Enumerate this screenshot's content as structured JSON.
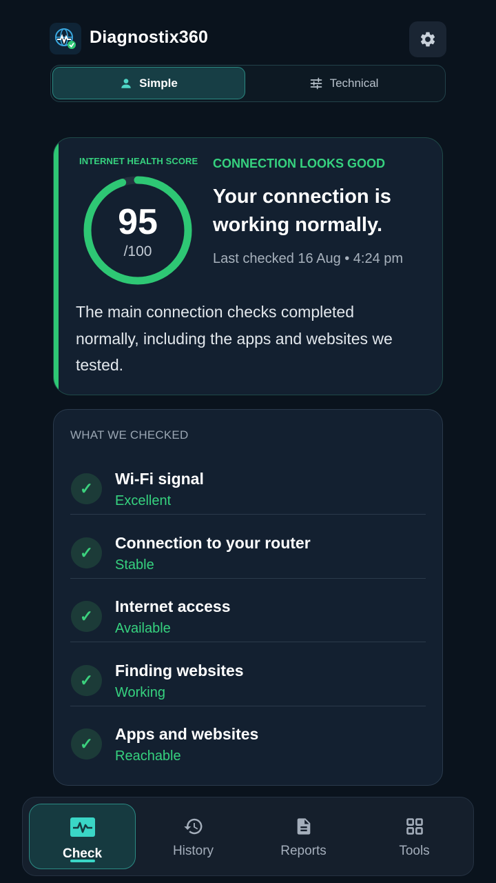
{
  "app": {
    "title": "Diagnostix360"
  },
  "mode_toggle": {
    "simple_label": "Simple",
    "technical_label": "Technical",
    "selected": "Simple"
  },
  "score_card": {
    "score_label": "INTERNET HEALTH SCORE",
    "score": "95",
    "score_max": "/100",
    "score_fraction": 0.95,
    "status_label": "CONNECTION LOOKS GOOD",
    "headline": "Your connection is working normally.",
    "last_checked": "Last checked 16 Aug • 4:24 pm",
    "summary": "The main connection checks completed normally, including the apps and websites we tested."
  },
  "checks": {
    "title": "WHAT WE CHECKED",
    "items": [
      {
        "name": "Wi-Fi signal",
        "status": "Excellent"
      },
      {
        "name": "Connection to your router",
        "status": "Stable"
      },
      {
        "name": "Internet access",
        "status": "Available"
      },
      {
        "name": "Finding websites",
        "status": "Working"
      },
      {
        "name": "Apps and websites",
        "status": "Reachable"
      }
    ]
  },
  "bottom_nav": {
    "items": [
      {
        "label": "Check",
        "icon": "pulse-icon"
      },
      {
        "label": "History",
        "icon": "history-icon"
      },
      {
        "label": "Reports",
        "icon": "document-icon"
      },
      {
        "label": "Tools",
        "icon": "grid-icon"
      }
    ],
    "active": "Check"
  },
  "colors": {
    "background": "#0a131d",
    "card": "#132030",
    "accent_green": "#36d27f",
    "accent_teal": "#3ad6c6",
    "active_tab": "#173e45"
  }
}
